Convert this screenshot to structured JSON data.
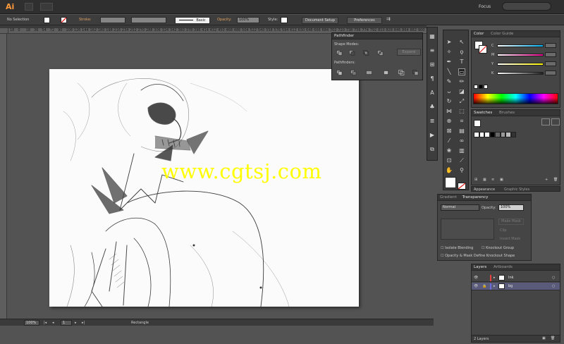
{
  "app": {
    "logo": "Ai",
    "workspace": "Focus"
  },
  "control_bar": {
    "selection": "No Selection",
    "stroke_label": "Stroke:",
    "brush_style": "Basic",
    "opacity_label": "Opacity:",
    "opacity_value": "100%",
    "style_label": "Style:",
    "document_setup": "Document Setup",
    "preferences": "Preferences"
  },
  "ruler": {
    "h_ticks": [
      "18",
      "0",
      "18",
      "36",
      "54",
      "72",
      "90",
      "108",
      "126",
      "144",
      "162",
      "180",
      "198",
      "216",
      "234",
      "252",
      "270",
      "288",
      "306",
      "324",
      "342",
      "360",
      "378",
      "396",
      "414",
      "432",
      "450",
      "468",
      "486",
      "504",
      "522",
      "540",
      "558",
      "576",
      "594",
      "612",
      "630",
      "648",
      "666",
      "684",
      "702",
      "720",
      "738",
      "756",
      "774",
      "792",
      "810",
      "828",
      "846",
      "864",
      "882",
      "900"
    ]
  },
  "watermark": {
    "text": "www.cgtsj.com"
  },
  "status_bar": {
    "zoom": "100%",
    "page": "1",
    "tool": "Rectangle"
  },
  "pathfinder": {
    "title": "Pathfinder",
    "shape_modes": "Shape Modes:",
    "expand": "Expand",
    "pathfinders": "Pathfinders:"
  },
  "color_panel": {
    "tabs": [
      "Color",
      "Color Guide"
    ],
    "channels": [
      "C",
      "M",
      "Y",
      "K"
    ],
    "channel_colors": [
      "#00aeef",
      "#ec008c",
      "#fff200",
      "#231f20"
    ]
  },
  "swatches_panel": {
    "tabs": [
      "Swatches",
      "Brushes"
    ]
  },
  "appearance_strip": {
    "tabs": [
      "Appearance",
      "Graphic Styles"
    ]
  },
  "transparency_panel": {
    "tabs": [
      "Gradient",
      "Transparency"
    ],
    "blend_mode": "Normal",
    "opacity_label": "Opacity:",
    "opacity_value": "100%",
    "make_mask": "Make Mask",
    "clip": "Clip",
    "invert_mask": "Invert Mask",
    "isolate_blending": "Isolate Blending",
    "knockout_group": "Knockout Group",
    "opacity_mask_define": "Opacity & Mask Define Knockout Shape"
  },
  "layers_panel": {
    "tabs": [
      "Layers",
      "Artboards"
    ],
    "rows": [
      {
        "name": "Ink",
        "color": "#e8403a"
      },
      {
        "name": "bg",
        "color": "#6d6dd9"
      }
    ],
    "footer": "2 Layers"
  }
}
